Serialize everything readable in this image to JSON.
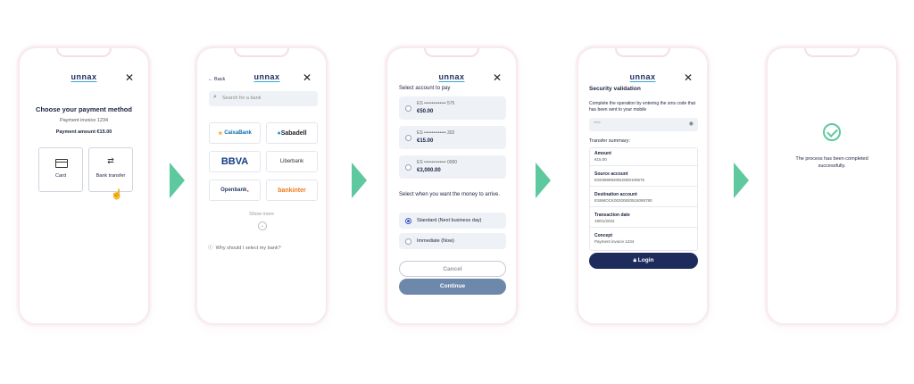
{
  "brand": {
    "logo": "unnax",
    "accent": "#2fa8d8",
    "primary": "#1d2c5c",
    "arrow_color": "#5ec89f"
  },
  "screen1": {
    "title": "Choose your payment method",
    "invoice": "Payment invoice 1234",
    "amount": "Payment amount €15.00",
    "options": [
      {
        "label": "Card",
        "icon": "card-icon"
      },
      {
        "label": "Bank transfer",
        "icon": "transfer-icon"
      }
    ]
  },
  "screen2": {
    "back": "Back",
    "search_placeholder": "Search for a bank",
    "banks": [
      "CaixaBank",
      "Sabadell",
      "BBVA",
      "Liberbank",
      "Openbank",
      "bankinter"
    ],
    "show_more": "Show more",
    "help": "Why should I select my bank?"
  },
  "screen3": {
    "title": "Select account to pay",
    "accounts": [
      {
        "iban": "ES  ••••••••••••••  575",
        "balance": "€50.00"
      },
      {
        "iban": "ES  ••••••••••••••  302",
        "balance": "€15.00"
      },
      {
        "iban": "ES  ••••••••••••••  0000",
        "balance": "€3,000.00"
      }
    ],
    "when_title": "Select when you want the money to arrive.",
    "when_options": [
      {
        "label": "Standard (Next business day)",
        "selected": true
      },
      {
        "label": "Immediate (Now)",
        "selected": false
      }
    ],
    "cancel": "Cancel",
    "continue": "Continue"
  },
  "screen4": {
    "title": "Security validation",
    "instructions": "Complete the operation by entering the sms code that has been sent to your mobile",
    "code_placeholder": "****",
    "summary_title": "Transfer summary:",
    "rows": [
      {
        "label": "Amount",
        "value": "€15.00"
      },
      {
        "label": "Source account",
        "value": "ES03999920910000100575"
      },
      {
        "label": "Destination account",
        "value": "ES8MOCK00200920515095780"
      },
      {
        "label": "Transaction date",
        "value": "19/01/2022"
      },
      {
        "label": "Concept",
        "value": "Payment invoice 1234"
      }
    ],
    "login": "Login"
  },
  "screen5": {
    "message": "The process has been completed successfully."
  }
}
